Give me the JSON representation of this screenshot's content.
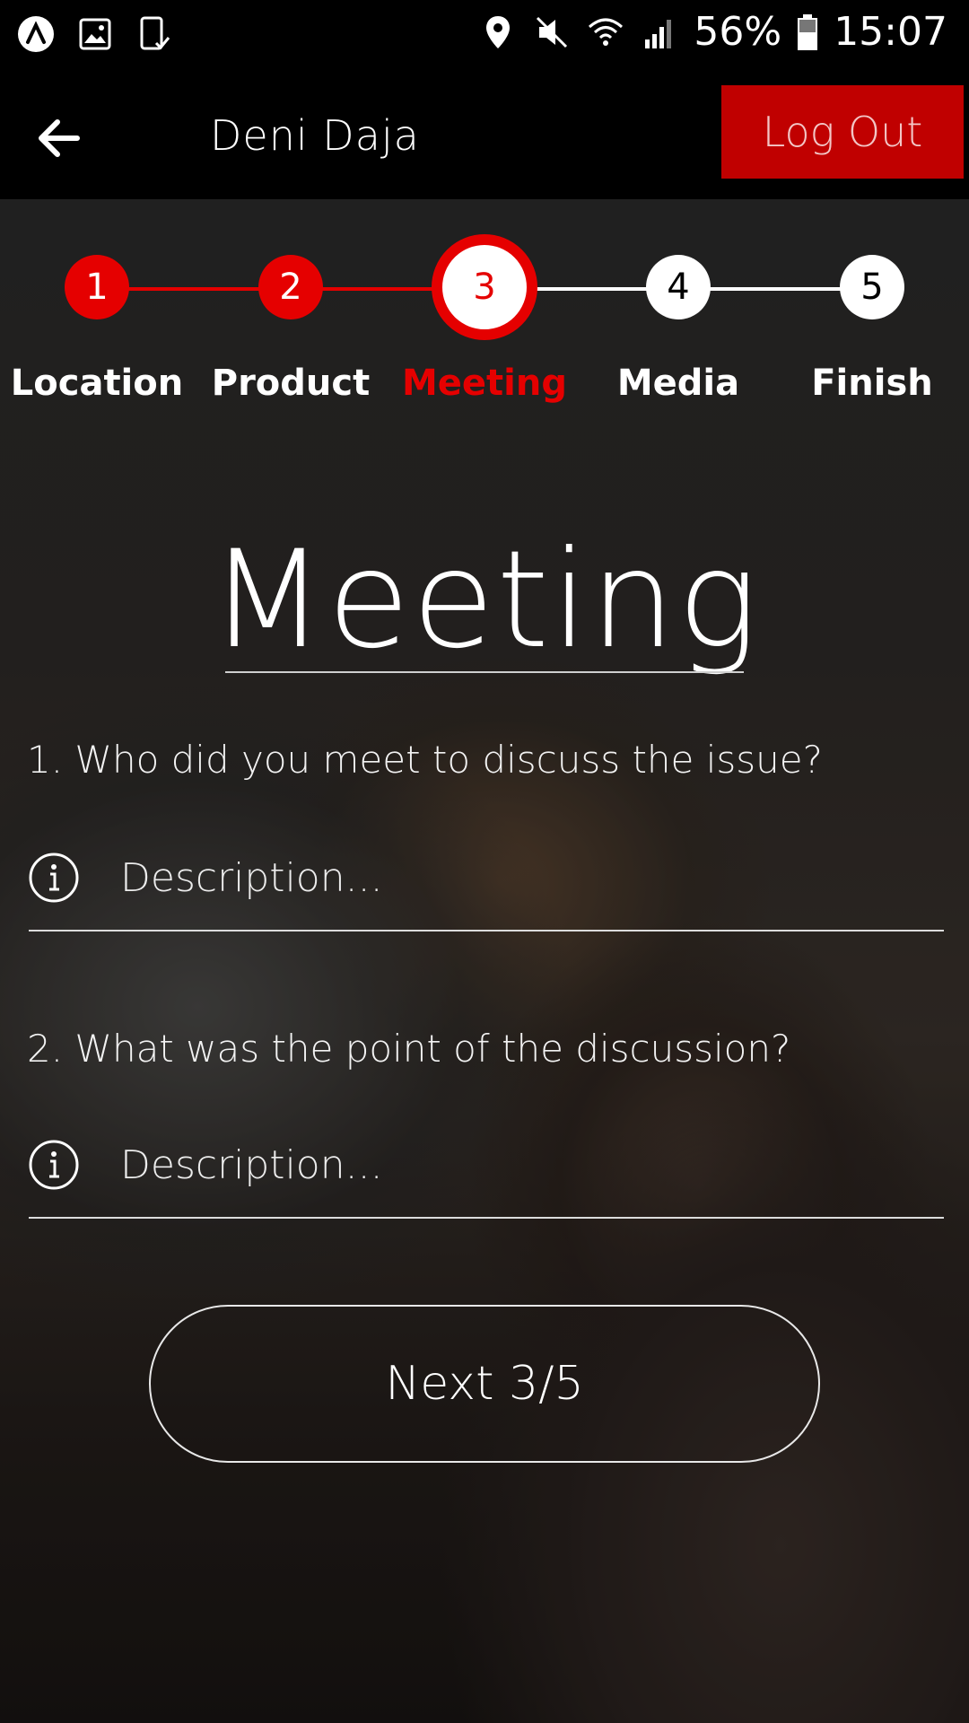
{
  "status_bar": {
    "battery": "56%",
    "time": "15:07",
    "icons": [
      "app-icon",
      "gallery-icon",
      "device-check-icon",
      "location-icon",
      "mute-icon",
      "wifi-icon",
      "signal-icon",
      "battery-icon"
    ]
  },
  "header": {
    "user_name": "Deni Daja",
    "logout_label": "Log Out",
    "accent_color": "#c00000"
  },
  "stepper": {
    "current": 3,
    "total": 5,
    "steps": [
      {
        "number": "1",
        "label": "Location",
        "state": "done"
      },
      {
        "number": "2",
        "label": "Product",
        "state": "done"
      },
      {
        "number": "3",
        "label": "Meeting",
        "state": "active"
      },
      {
        "number": "4",
        "label": "Media",
        "state": "todo"
      },
      {
        "number": "5",
        "label": "Finish",
        "state": "todo"
      }
    ],
    "active_color": "#e50000"
  },
  "page": {
    "title": "Meeting",
    "questions": [
      {
        "text": "1. Who did you meet to discuss the issue?",
        "placeholder": "Description...",
        "value": ""
      },
      {
        "text": "2. What was the point of the discussion?",
        "placeholder": "Description...",
        "value": ""
      }
    ],
    "next_label": "Next 3/5"
  }
}
